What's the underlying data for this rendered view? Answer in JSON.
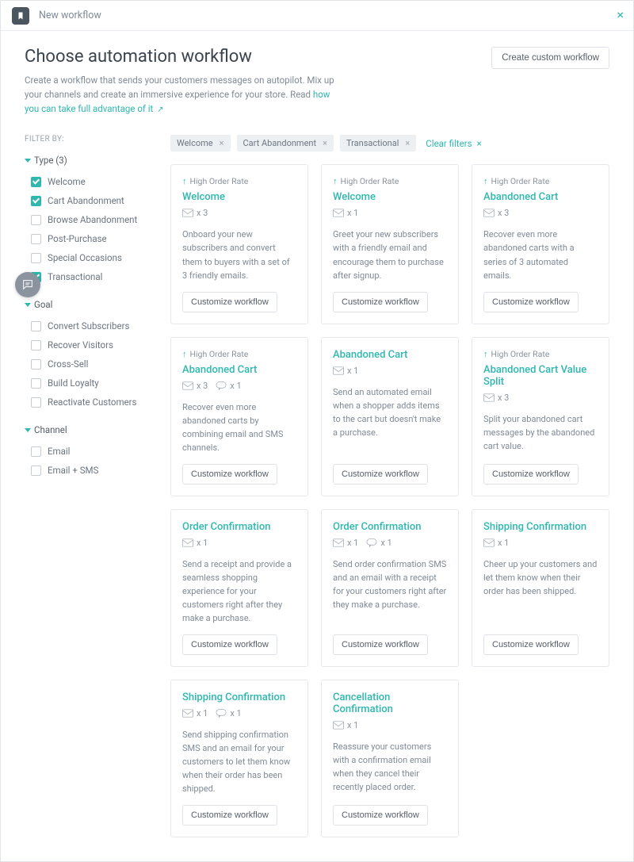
{
  "topbar": {
    "title": "New workflow"
  },
  "page": {
    "heading": "Choose automation workflow",
    "create_btn": "Create custom workflow",
    "subtitle_pre": "Create a workflow that sends your customers messages on autopilot. Mix up your channels and create an immersive experience for your store. Read ",
    "subtitle_link": "how you can take full advantage of it"
  },
  "sidebar": {
    "filter_by": "FILTER BY:",
    "groups": [
      {
        "label": "Type (3)",
        "items": [
          {
            "label": "Welcome",
            "checked": true
          },
          {
            "label": "Cart Abandonment",
            "checked": true
          },
          {
            "label": "Browse Abandonment",
            "checked": false
          },
          {
            "label": "Post-Purchase",
            "checked": false
          },
          {
            "label": "Special Occasions",
            "checked": false
          },
          {
            "label": "Transactional",
            "checked": true
          }
        ]
      },
      {
        "label": "Goal",
        "items": [
          {
            "label": "Convert Subscribers",
            "checked": false
          },
          {
            "label": "Recover Visitors",
            "checked": false
          },
          {
            "label": "Cross-Sell",
            "checked": false
          },
          {
            "label": "Build Loyalty",
            "checked": false
          },
          {
            "label": "Reactivate Customers",
            "checked": false
          }
        ]
      },
      {
        "label": "Channel",
        "items": [
          {
            "label": "Email",
            "checked": false
          },
          {
            "label": "Email + SMS",
            "checked": false
          }
        ]
      }
    ]
  },
  "chips": [
    "Welcome",
    "Cart Abandonment",
    "Transactional"
  ],
  "clear_filters": "Clear filters",
  "btn_label": "Customize workflow",
  "cards": [
    {
      "badge": "High Order Rate",
      "title": "Welcome",
      "email": "x 3",
      "sms": null,
      "desc": "Onboard your new subscribers and convert them to buyers with a set of 3 friendly emails."
    },
    {
      "badge": "High Order Rate",
      "title": "Welcome",
      "email": "x 1",
      "sms": null,
      "desc": "Greet your new subscribers with a friendly email and encourage them to purchase after signup."
    },
    {
      "badge": "High Order Rate",
      "title": "Abandoned Cart",
      "email": "x 3",
      "sms": null,
      "desc": "Recover even more abandoned carts with a series of 3 automated emails."
    },
    {
      "badge": "High Order Rate",
      "title": "Abandoned Cart",
      "email": "x 3",
      "sms": "x 1",
      "desc": "Recover even more abandoned carts by combining email and SMS channels."
    },
    {
      "badge": null,
      "title": "Abandoned Cart",
      "email": "x 1",
      "sms": null,
      "desc": "Send an automated email when a shopper adds items to the cart but doesn't make a purchase."
    },
    {
      "badge": "High Order Rate",
      "title": "Abandoned Cart Value Split",
      "email": "x 3",
      "sms": null,
      "desc": "Split your abandoned cart messages by the abandoned cart value."
    },
    {
      "badge": null,
      "title": "Order Confirmation",
      "email": "x 1",
      "sms": null,
      "desc": "Send a receipt and provide a seamless shopping experience for your customers right after they make a purchase."
    },
    {
      "badge": null,
      "title": "Order Confirmation",
      "email": "x 1",
      "sms": "x 1",
      "desc": "Send order confirmation SMS and an email with a receipt for your customers right after they make a purchase."
    },
    {
      "badge": null,
      "title": "Shipping Confirmation",
      "email": "x 1",
      "sms": null,
      "desc": "Cheer up your customers and let them know when their order has been shipped."
    },
    {
      "badge": null,
      "title": "Shipping Confirmation",
      "email": "x 1",
      "sms": "x 1",
      "desc": "Send shipping confirmation SMS and an email for your customers to let them know when their order has been shipped."
    },
    {
      "badge": null,
      "title": "Cancellation Confirmation",
      "email": "x 1",
      "sms": null,
      "desc": "Reassure your customers with a confirmation email when they cancel their recently placed order."
    }
  ]
}
